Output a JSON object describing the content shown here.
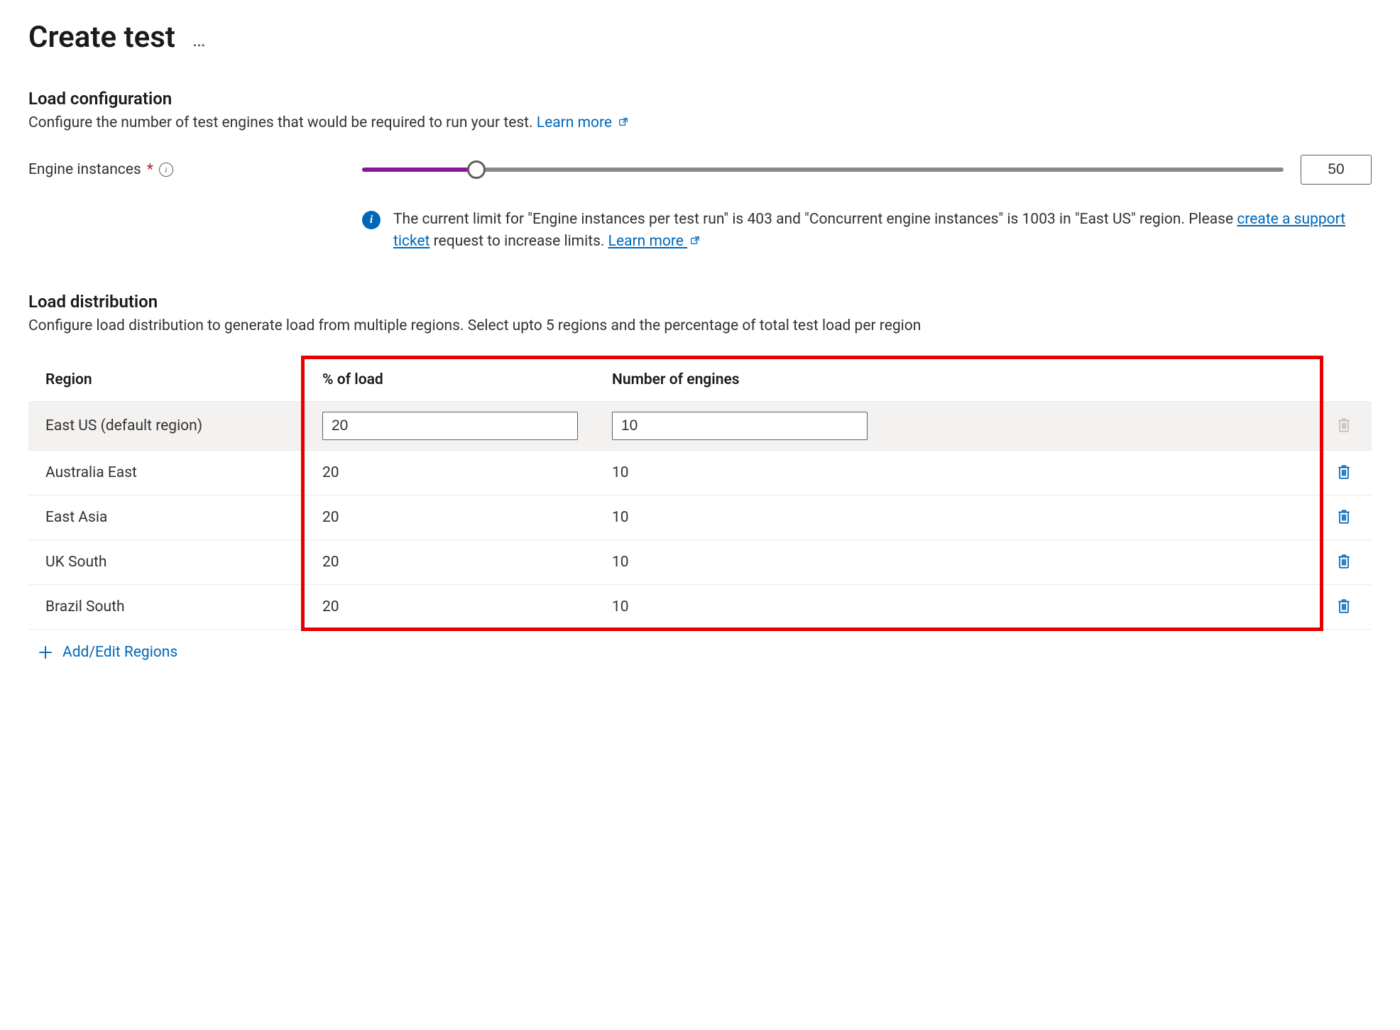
{
  "page": {
    "title": "Create test"
  },
  "load_config": {
    "heading": "Load configuration",
    "description": "Configure the number of test engines that would be required to run your test. ",
    "learn_more": "Learn more",
    "slider_label": "Engine instances",
    "required_marker": "*",
    "slider_value": "50",
    "info_message_part1": "The current limit for \"Engine instances per test run\" is 403 and \"Concurrent engine instances\" is 1003 in \"East US\" region. Please ",
    "info_message_link1": "create a support ticket",
    "info_message_part2": " request to increase limits. ",
    "info_message_link2": "Learn more"
  },
  "load_dist": {
    "heading": "Load distribution",
    "description": "Configure load distribution to generate load from multiple regions. Select upto 5 regions and the percentage of total test load per region",
    "columns": {
      "region": "Region",
      "load": "% of load",
      "engines": "Number of engines"
    },
    "rows": [
      {
        "region": "East US (default region)",
        "load": "20",
        "engines": "10",
        "editable": true,
        "deletable": false
      },
      {
        "region": "Australia East",
        "load": "20",
        "engines": "10",
        "editable": false,
        "deletable": true
      },
      {
        "region": "East Asia",
        "load": "20",
        "engines": "10",
        "editable": false,
        "deletable": true
      },
      {
        "region": "UK South",
        "load": "20",
        "engines": "10",
        "editable": false,
        "deletable": true
      },
      {
        "region": "Brazil South",
        "load": "20",
        "engines": "10",
        "editable": false,
        "deletable": true
      }
    ],
    "add_label": "Add/Edit Regions"
  }
}
